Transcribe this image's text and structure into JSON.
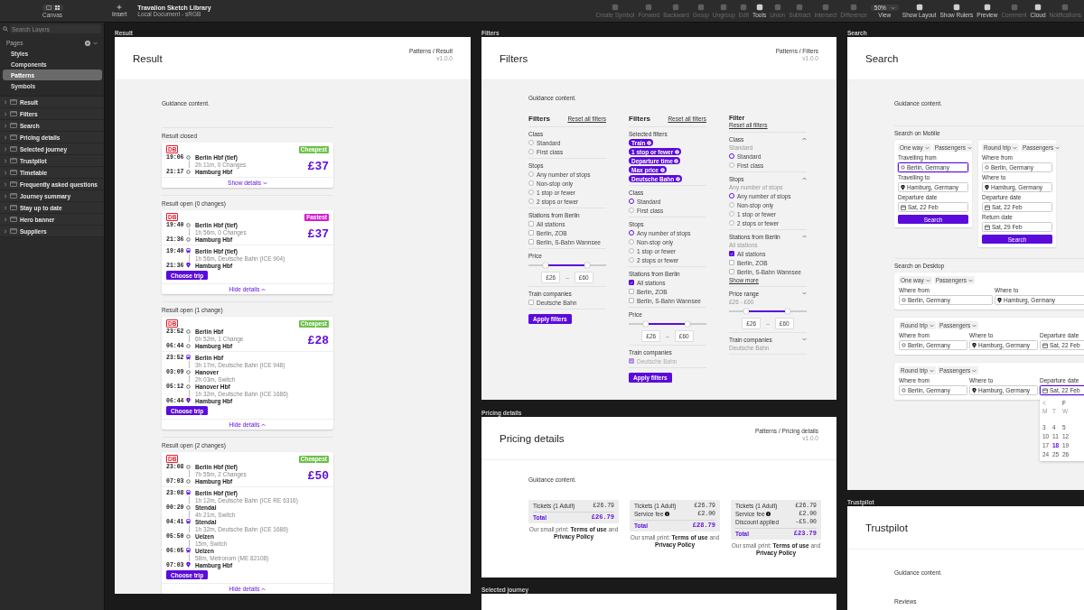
{
  "toolbar": {
    "canvas_label": "Canvas",
    "insert_label": "Insert",
    "document_title": "Travalion Sketch Library",
    "document_subtitle": "Local Document - sRGB",
    "tools": [
      {
        "kind": "icon",
        "label": "Create Symbol",
        "disabled": true
      },
      {
        "kind": "icon",
        "label": "Forward",
        "disabled": true
      },
      {
        "kind": "icon",
        "label": "Backward",
        "disabled": true
      },
      {
        "kind": "icon",
        "label": "Group",
        "disabled": true
      },
      {
        "kind": "icon",
        "label": "Ungroup",
        "disabled": true
      },
      {
        "kind": "icon",
        "label": "Edit",
        "disabled": true
      },
      {
        "kind": "icon",
        "label": "Tools",
        "disabled": false
      },
      {
        "kind": "icon",
        "label": "Union",
        "disabled": true
      },
      {
        "kind": "icon",
        "label": "Subtract",
        "disabled": true
      },
      {
        "kind": "icon",
        "label": "Intersect",
        "disabled": true
      },
      {
        "kind": "icon",
        "label": "Difference",
        "disabled": true
      },
      {
        "kind": "zoom",
        "value": "50%",
        "label": "View",
        "disabled": false
      },
      {
        "kind": "icon",
        "label": "Show Layout",
        "disabled": false
      },
      {
        "kind": "icon",
        "label": "Show Rulers",
        "disabled": false
      },
      {
        "kind": "icon",
        "label": "Preview",
        "disabled": false
      },
      {
        "kind": "icon",
        "label": "Comment",
        "disabled": true
      },
      {
        "kind": "icon",
        "label": "Cloud",
        "disabled": false
      },
      {
        "kind": "icon",
        "label": "Notifications",
        "disabled": true
      }
    ]
  },
  "sidebar": {
    "search": {
      "placeholder": "Search Layers"
    },
    "pages_heading": "Pages",
    "pages": [
      {
        "label": "Styles",
        "selected": false
      },
      {
        "label": "Components",
        "selected": false
      },
      {
        "label": "Patterns",
        "selected": true
      },
      {
        "label": "Symbols",
        "selected": false
      }
    ],
    "layers": [
      {
        "label": "Result",
        "expanded": false
      },
      {
        "label": "Filters",
        "expanded": false
      },
      {
        "label": "Search",
        "expanded": false
      },
      {
        "label": "Pricing details",
        "expanded": false
      },
      {
        "label": "Selected journey",
        "expanded": false
      },
      {
        "label": "Trustpilot",
        "expanded": false
      },
      {
        "label": "Timetable",
        "expanded": false
      },
      {
        "label": "Frequently asked questions",
        "expanded": false
      },
      {
        "label": "Journey summary",
        "expanded": false
      },
      {
        "label": "Stay up to date",
        "expanded": false
      },
      {
        "label": "Hero banner",
        "expanded": false
      },
      {
        "label": "Suppliers",
        "expanded": false
      }
    ]
  },
  "result": {
    "label": "Result",
    "title": "Result",
    "breadcrumb": "Patterns / Result",
    "version": "v1.0.0",
    "guidance": "Guidance content.",
    "sections": [
      {
        "heading": "Result closed",
        "card": {
          "logo": "DB",
          "badge": {
            "label": "Cheapest",
            "color": "#6cc04a"
          },
          "stops": [
            {
              "time": "19:06",
              "name": "Berlin Hbf (tief)",
              "kind": "station"
            },
            {
              "time": "21:17",
              "name": "Hamburg Hbf",
              "kind": "station"
            }
          ],
          "durations": [
            "2h 11m, 0 Changes"
          ],
          "price": "£37",
          "expanded": false,
          "toggle": "Show details"
        }
      },
      {
        "heading": "Result open (0 changes)",
        "card": {
          "logo": "DB",
          "badge": {
            "label": "Fastest",
            "color": "#d21fd1"
          },
          "stops": [
            {
              "time": "19:40",
              "name": "Berlin Hbf (tief)",
              "kind": "station"
            },
            {
              "time": "21:36",
              "name": "Hamburg Hbf",
              "kind": "station"
            }
          ],
          "durations": [
            "1h 56m, 0 Changes"
          ],
          "price": "£37",
          "expanded": true,
          "toggle": "Hide details",
          "details": {
            "stops": [
              {
                "time": "19:40",
                "name": "Berlin Hbf (tief)",
                "kind": "boarding"
              },
              {
                "time": "21:36",
                "name": "Hamburg Hbf",
                "kind": "arrival"
              }
            ],
            "durations": [
              "1h 56m, Deutsche Bahn (ICE 904)"
            ],
            "button": "Choose trip"
          }
        }
      },
      {
        "heading": "Result open (1 change)",
        "card": {
          "logo": "DB",
          "badge": {
            "label": "Cheapest",
            "color": "#6cc04a"
          },
          "stops": [
            {
              "time": "23:52",
              "name": "Berlin Hbf",
              "kind": "station"
            },
            {
              "time": "06:44",
              "name": "Hamburg Hbf",
              "kind": "station"
            }
          ],
          "durations": [
            "6h 52m, 1 Change"
          ],
          "price": "£28",
          "expanded": true,
          "toggle": "Hide details",
          "details": {
            "stops": [
              {
                "time": "23:52",
                "name": "Berlin Hbf",
                "kind": "boarding"
              },
              {
                "time": "03:09",
                "name": "Hanover",
                "kind": "station"
              },
              {
                "time": "05:12",
                "name": "Hanover Hbf",
                "kind": "station"
              },
              {
                "time": "06:44",
                "name": "Hamburg Hbf",
                "kind": "arrival"
              }
            ],
            "durations": [
              "3h 17m, Deutsche Bahn (ICE 948)",
              "2h 03m, Switch",
              "1h 32m, Deutsche Bahn (ICE 1686)"
            ],
            "button": "Choose trip"
          }
        }
      },
      {
        "heading": "Result open (2 changes)",
        "card": {
          "logo": "DB",
          "badge": {
            "label": "Cheapest",
            "color": "#6cc04a"
          },
          "stops": [
            {
              "time": "23:08",
              "name": "Berlin Hbf (tief)",
              "kind": "station"
            },
            {
              "time": "07:03",
              "name": "Hamburg Hbf",
              "kind": "station"
            }
          ],
          "durations": [
            "7h 55m, 2 Changes"
          ],
          "price": "£50",
          "expanded": true,
          "toggle": "Hide details",
          "details": {
            "stops": [
              {
                "time": "23:08",
                "name": "Berlin Hbf (tief)",
                "kind": "boarding"
              },
              {
                "time": "00:20",
                "name": "Stendal",
                "kind": "station"
              },
              {
                "time": "04:41",
                "name": "Stendal",
                "kind": "boarding"
              },
              {
                "time": "05:50",
                "name": "Uelzen",
                "kind": "station"
              },
              {
                "time": "06:05",
                "name": "Uelzen",
                "kind": "boarding"
              },
              {
                "time": "07:03",
                "name": "Hamburg Hbf",
                "kind": "arrival"
              }
            ],
            "durations": [
              "1h 12m, Deutsche Bahn (ICE RE 6316)",
              "4h 21m, Switch",
              "1h 32m, Deutsche Bahn (ICE 1686)",
              "15m, Switch",
              "58m, Metronom (ME 82108)"
            ],
            "button": "Choose trip"
          }
        }
      }
    ]
  },
  "filters": {
    "label": "Filters",
    "title": "Filters",
    "breadcrumb": "Patterns / Filters",
    "version": "v1.0.0",
    "guidance": "Guidance content.",
    "panels": [
      {
        "kind": "list",
        "title": "Filters",
        "reset": "Reset all filters",
        "button": "Apply filters",
        "groups": [
          {
            "kind": "radio",
            "title": "Class",
            "options": [
              {
                "label": "Standard",
                "selected": false
              },
              {
                "label": "First class",
                "selected": false
              }
            ]
          },
          {
            "kind": "radio",
            "title": "Stops",
            "options": [
              {
                "label": "Any number of stops",
                "selected": false
              },
              {
                "label": "Non-stop only",
                "selected": false
              },
              {
                "label": "1 stop or fewer",
                "selected": false
              },
              {
                "label": "2 stops or fewer",
                "selected": false
              }
            ]
          },
          {
            "kind": "checkbox",
            "title": "Stations from Berlin",
            "options": [
              {
                "label": "All stations",
                "checked": false,
                "disabled": false
              },
              {
                "label": "Berlin, ZOB",
                "checked": false,
                "disabled": false
              },
              {
                "label": "Berlin, S-Bahn Wannsee",
                "checked": false,
                "disabled": false
              }
            ]
          },
          {
            "kind": "range",
            "title": "Price",
            "range": {
              "low": {
                "level": 0.22,
                "value": "£26"
              },
              "high": {
                "level": 0.76,
                "value": "£60"
              },
              "separator": "–"
            }
          },
          {
            "kind": "checkbox",
            "title": "Train companies",
            "options": [
              {
                "label": "Deutsche Bahn",
                "checked": false,
                "disabled": false
              }
            ]
          }
        ]
      },
      {
        "kind": "list",
        "title": "Filters",
        "reset": "Reset all filters",
        "button": "Apply filters",
        "groups": [
          {
            "kind": "chips",
            "title": "Selected filters",
            "chips": [
              "Train",
              "1 stop or fewer",
              "Departure time",
              "Max price",
              "Deutsche Bahn"
            ]
          },
          {
            "kind": "radio",
            "title": "Class",
            "options": [
              {
                "label": "Standard",
                "selected": true
              },
              {
                "label": "First class",
                "selected": false
              }
            ]
          },
          {
            "kind": "radio",
            "title": "Stops",
            "options": [
              {
                "label": "Any number of stops",
                "selected": true
              },
              {
                "label": "Non-stop only",
                "selected": false
              },
              {
                "label": "1 stop or fewer",
                "selected": false
              },
              {
                "label": "2 stops or fewer",
                "selected": false
              }
            ]
          },
          {
            "kind": "checkbox",
            "title": "Stations from Berlin",
            "options": [
              {
                "label": "All stations",
                "checked": true,
                "disabled": false
              },
              {
                "label": "Berlin, ZOB",
                "checked": false,
                "disabled": false
              },
              {
                "label": "Berlin, S-Bahn Wannsee",
                "checked": false,
                "disabled": false
              }
            ]
          },
          {
            "kind": "range",
            "title": "Price",
            "range": {
              "low": {
                "level": 0.22,
                "value": "£26"
              },
              "high": {
                "level": 0.76,
                "value": "£60"
              },
              "separator": "–"
            }
          },
          {
            "kind": "checkbox",
            "title": "Train companies",
            "options": [
              {
                "label": "Deutsche Bahn",
                "checked": true,
                "disabled": true
              }
            ]
          }
        ]
      },
      {
        "kind": "accordion",
        "title": "Filter",
        "reset": "Reset all filters",
        "groups": [
          {
            "kind": "radio",
            "title": "Class",
            "subtitle": "Standard",
            "expanded": true,
            "options": [
              {
                "label": "Standard",
                "selected": true
              },
              {
                "label": "First class",
                "selected": false
              }
            ]
          },
          {
            "kind": "radio",
            "title": "Stops",
            "subtitle": "Any number of stops",
            "expanded": true,
            "options": [
              {
                "label": "Any number of stops",
                "selected": true
              },
              {
                "label": "Non-stop only",
                "selected": false
              },
              {
                "label": "1 stop or fewer",
                "selected": false
              },
              {
                "label": "2 stops or fewer",
                "selected": false
              }
            ]
          },
          {
            "kind": "checkbox",
            "title": "Stations from Berlin",
            "subtitle": "All stations",
            "expanded": true,
            "link": "Show more",
            "options": [
              {
                "label": "All stations",
                "checked": true,
                "disabled": false
              },
              {
                "label": "Berlin, ZOB",
                "checked": false,
                "disabled": false
              },
              {
                "label": "Berlin, S-Bahn Wannsee",
                "checked": false,
                "disabled": false
              }
            ]
          },
          {
            "kind": "range",
            "title": "Price range",
            "subtitle": "£26 - £60",
            "expanded": false,
            "range": {
              "low": {
                "level": 0.22,
                "value": "£26"
              },
              "high": {
                "level": 0.76,
                "value": "£60"
              },
              "separator": "–"
            }
          },
          {
            "kind": "none",
            "title": "Train companies",
            "subtitle": "Deutsche Bahn",
            "expanded": false
          }
        ]
      }
    ]
  },
  "pricing": {
    "label": "Pricing details",
    "title": "Pricing details",
    "breadcrumb": "Patterns / Pricing details",
    "version": "v1.0.0",
    "guidance": "Guidance content.",
    "boxes": [
      {
        "rows": [
          {
            "label": "Tickets (1 Adult)",
            "amount": "£26.79",
            "info": false
          }
        ],
        "total_label": "Total",
        "total": "£26.79",
        "small_print": {
          "before": "Our small print:",
          "link1": "Terms of use",
          "middle": "and",
          "link2": "Privacy Policy"
        }
      },
      {
        "rows": [
          {
            "label": "Tickets (1 Adult)",
            "amount": "£26.79",
            "info": false
          },
          {
            "label": "Service fee",
            "amount": "£2.00",
            "info": true
          }
        ],
        "total_label": "Total",
        "total": "£28.79",
        "small_print": {
          "before": "Our small print:",
          "link1": "Terms of use",
          "middle": "and",
          "link2": "Privacy Policy"
        }
      },
      {
        "rows": [
          {
            "label": "Tickets (1 Adult)",
            "amount": "£26.79",
            "info": false
          },
          {
            "label": "Service fee",
            "amount": "£2.00",
            "info": true
          },
          {
            "label": "Discount applied",
            "amount": "-£5.00",
            "info": false
          }
        ],
        "total_label": "Total",
        "total": "£23.79",
        "small_print": {
          "before": "Our small print:",
          "link1": "Terms of use",
          "middle": "and",
          "link2": "Privacy Policy"
        }
      }
    ]
  },
  "selected_journey": {
    "label": "Selected journey"
  },
  "search": {
    "label": "Search",
    "title": "Search",
    "guidance": "Guidance content.",
    "groups": [
      {
        "heading": "Search on Mobile",
        "kind": "mobile",
        "cards": [
          {
            "trip_type": "One way",
            "passengers": "Passengers",
            "button": "Search",
            "fields": [
              {
                "label": "Travelling from",
                "value": "Berlin, Germany",
                "kind": "origin",
                "focused": true
              },
              {
                "label": "Travelling to",
                "value": "Hamburg, Germany",
                "kind": "destination",
                "focused": false
              },
              {
                "label": "Departure date",
                "value": "Sat, 22 Feb",
                "kind": "date",
                "focused": false
              }
            ]
          },
          {
            "trip_type": "Round trip",
            "passengers": "Passengers",
            "button": "Search",
            "fields": [
              {
                "label": "Where from",
                "value": "Berlin, Germany",
                "kind": "origin",
                "focused": false
              },
              {
                "label": "Where to",
                "value": "Hamburg, Germany",
                "kind": "destination",
                "focused": false
              },
              {
                "label": "Departure date",
                "value": "Sat, 22 Feb",
                "kind": "date",
                "focused": false
              },
              {
                "label": "Return date",
                "value": "Sat, 29 Feb",
                "kind": "date",
                "focused": false
              }
            ]
          }
        ]
      },
      {
        "heading": "Search on Desktop",
        "kind": "desktop",
        "cards": [
          {
            "trip_type": "One way",
            "passengers": "Passengers",
            "fields": [
              {
                "label": "Where from",
                "value": "Berlin, Germany",
                "kind": "origin",
                "focused": false
              },
              {
                "label": "Where to",
                "value": "Hamburg, Germany",
                "kind": "destination",
                "focused": false
              }
            ]
          },
          {
            "trip_type": "Round trip",
            "passengers": "Passengers",
            "fields": [
              {
                "label": "Where from",
                "value": "Berlin, Germany",
                "kind": "origin",
                "focused": false
              },
              {
                "label": "Where to",
                "value": "Hamburg, Germany",
                "kind": "destination",
                "focused": false
              },
              {
                "label": "Departure date",
                "value": "Sat, 22 Feb",
                "kind": "date",
                "focused": false
              }
            ]
          },
          {
            "trip_type": "Round trip",
            "passengers": "Passengers",
            "fields": [
              {
                "label": "Where from",
                "value": "Berlin, Germany",
                "kind": "origin",
                "focused": false
              },
              {
                "label": "Where to",
                "value": "Hamburg, Germany",
                "kind": "destination",
                "focused": false
              },
              {
                "label": "Departure date",
                "value": "Sat, 22 Feb",
                "kind": "date",
                "focused": true,
                "calendar": {
                  "month": "F",
                  "weekdays": [
                    "M",
                    "T",
                    "W"
                  ],
                  "days": [
                    {
                      "label": "3",
                      "selected": false
                    },
                    {
                      "label": "4",
                      "selected": false
                    },
                    {
                      "label": "5",
                      "selected": false
                    },
                    {
                      "label": "10",
                      "selected": false
                    },
                    {
                      "label": "11",
                      "selected": false
                    },
                    {
                      "label": "12",
                      "selected": false
                    },
                    {
                      "label": "17",
                      "selected": false
                    },
                    {
                      "label": "18",
                      "selected": true
                    },
                    {
                      "label": "19",
                      "selected": false
                    },
                    {
                      "label": "24",
                      "selected": false
                    },
                    {
                      "label": "25",
                      "selected": false
                    },
                    {
                      "label": "26",
                      "selected": false
                    }
                  ]
                }
              }
            ]
          }
        ]
      }
    ]
  },
  "trustpilot": {
    "label": "Trustpilot",
    "title": "Trustpilot",
    "guidance": "Guidance content.",
    "section": "Reviews"
  }
}
